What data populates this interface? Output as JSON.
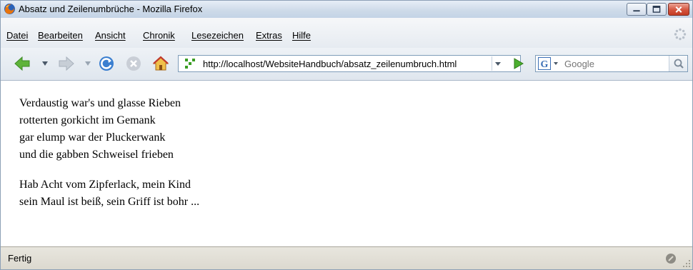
{
  "window": {
    "title": "Absatz und Zeilenumbrüche - Mozilla Firefox"
  },
  "menu": {
    "items": [
      {
        "label": "Datei"
      },
      {
        "label": "Bearbeiten"
      },
      {
        "label": "Ansicht"
      },
      {
        "label": "Chronik"
      },
      {
        "label": "Lesezeichen"
      },
      {
        "label": "Extras"
      },
      {
        "label": "Hilfe"
      }
    ]
  },
  "toolbar": {
    "url": "http://localhost/WebsiteHandbuch/absatz_zeilenumbruch.html",
    "search": {
      "placeholder": "Google",
      "engine": "G"
    }
  },
  "content": {
    "paragraph1": [
      "Verdaustig war's und glasse Rieben",
      "rotterten gorkicht im Gemank",
      "gar elump war der Pluckerwank",
      "und die gabben Schweisel frieben"
    ],
    "paragraph2": [
      "Hab Acht vom Zipferlack, mein Kind",
      "sein Maul ist beiß, sein Griff ist bohr ..."
    ]
  },
  "status": {
    "text": "Fertig"
  },
  "colors": {
    "titlebar": "#cfdbe9",
    "close_button": "#c43c24",
    "status_bar": "#dcd9cf"
  },
  "icons": [
    "firefox-icon",
    "back-icon",
    "forward-icon",
    "reload-icon",
    "stop-icon",
    "home-icon",
    "site-icon",
    "go-icon",
    "search-icon",
    "throbber-icon"
  ]
}
